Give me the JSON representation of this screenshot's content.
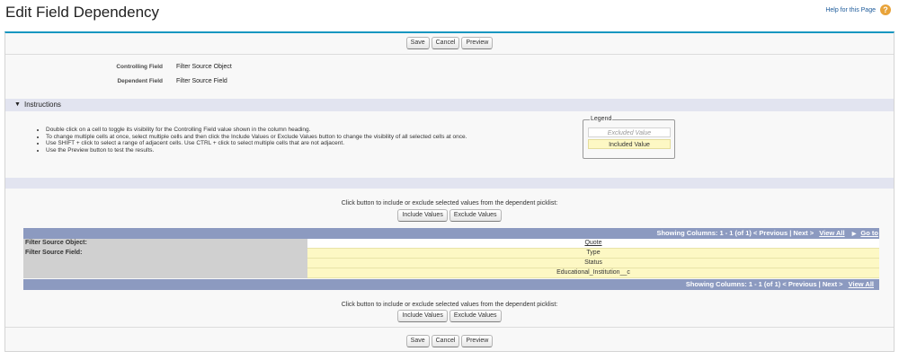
{
  "page": {
    "title": "Edit Field Dependency",
    "help_text": "Help for this Page",
    "help_icon": "question-circle-icon"
  },
  "buttons": {
    "save": "Save",
    "cancel": "Cancel",
    "preview": "Preview",
    "include": "Include Values",
    "exclude": "Exclude Values"
  },
  "fields": {
    "controlling_label": "Controlling Field",
    "controlling_value": "Filter Source Object",
    "dependent_label": "Dependent Field",
    "dependent_value": "Filter Source Field"
  },
  "instructions": {
    "title": "Instructions",
    "items": [
      "Double click on a cell to toggle its visibility for the Controlling Field value shown in the column heading.",
      "To change multiple cells at once, select multiple cells and then click the Include Values or Exclude Values button to change the visibility of all selected cells at once.",
      "Use SHIFT + click to select a range of adjacent cells. Use CTRL + click to select multiple cells that are not adjacent.",
      "Use the Preview button to test the results."
    ]
  },
  "legend": {
    "title": "Legend",
    "excluded": "Excluded Value",
    "included": "Included Value"
  },
  "hint_text": "Click button to include or exclude selected values from the dependent picklist:",
  "grid": {
    "nav_top": {
      "showing": "Showing Columns: 1 - 1 (of 1)",
      "previous": "< Previous",
      "sep1": "|",
      "next": "Next >",
      "view_all": "View All",
      "go_to": "Go to"
    },
    "nav_bottom": {
      "showing": "Showing Columns: 1 - 1 (of 1)",
      "previous": "< Previous",
      "sep1": "|",
      "next": "Next >",
      "view_all": "View All"
    },
    "controlling_row_label": "Filter Source Object:",
    "controlling_value": "Quote",
    "dependent_row_label": "Filter Source Field:",
    "dependent_values": [
      "Type",
      "Status",
      "Educational_Institution__c"
    ]
  },
  "colors": {
    "header_bar": "#8c9ac0",
    "included": "#fdf8c4",
    "section_bar": "#e2e4f0",
    "accent_top": "#1797c0"
  }
}
